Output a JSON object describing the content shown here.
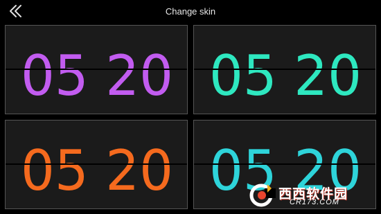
{
  "header": {
    "title": "Change skin",
    "back_icon": "chevron-left-icon"
  },
  "skins": [
    {
      "time": "05 20",
      "color": "#c25cf0"
    },
    {
      "time": "05 20",
      "color": "#2ee8c0"
    },
    {
      "time": "05 20",
      "color": "#f56a1e"
    },
    {
      "time": "05 20",
      "color": "#2ed4da"
    }
  ],
  "watermark": {
    "text": "西西软件园",
    "url": "CR173.COM"
  }
}
